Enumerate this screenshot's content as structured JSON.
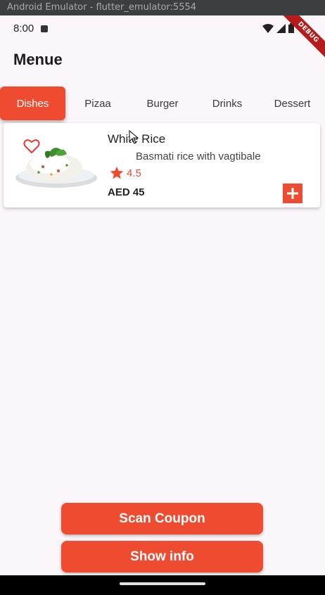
{
  "window": {
    "title": "Android Emulator - flutter_emulator:5554"
  },
  "status_bar": {
    "time": "8:00",
    "icons": [
      "app-notification-icon",
      "wifi-icon",
      "signal-icon",
      "battery-icon"
    ]
  },
  "debug_banner": {
    "label": "DEBUG",
    "color": "#b71c1c"
  },
  "page": {
    "title": "Menue"
  },
  "tabs": [
    {
      "label": "Dishes",
      "active": true
    },
    {
      "label": "Pizaa",
      "active": false
    },
    {
      "label": "Burger",
      "active": false
    },
    {
      "label": "Drinks",
      "active": false
    },
    {
      "label": "Dessert",
      "active": false
    }
  ],
  "items": [
    {
      "name": "White Rice",
      "description": "Basmati rice with vagtibale",
      "rating": "4.5",
      "price": "AED 45",
      "favorite_icon": "heart-outline-icon",
      "add_icon": "plus-icon"
    }
  ],
  "actions": {
    "scan_coupon": "Scan Coupon",
    "show_info": "Show info"
  },
  "colors": {
    "accent": "#ee4b31",
    "background": "#fbf6f9",
    "card": "#ffffff",
    "text": "#1d1b20"
  }
}
